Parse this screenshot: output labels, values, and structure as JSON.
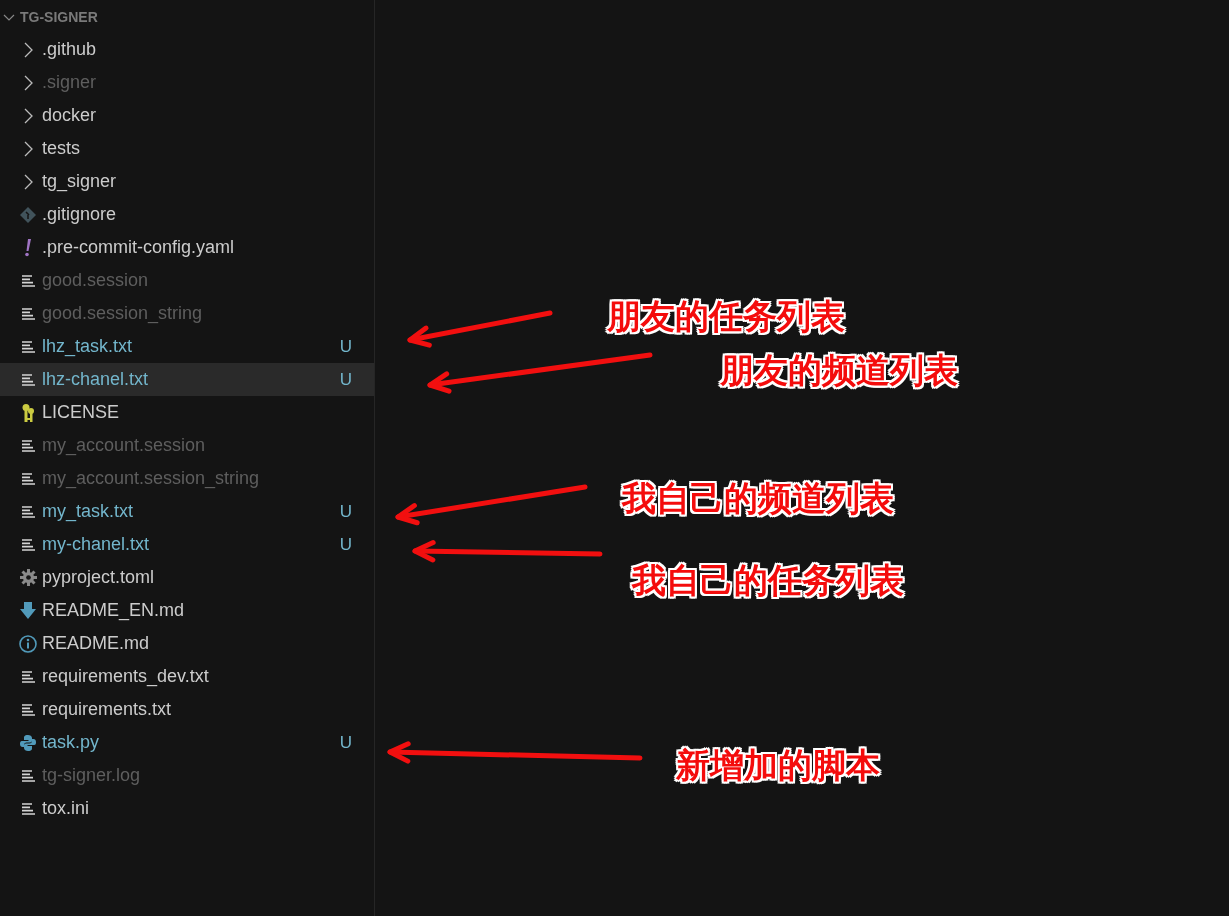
{
  "explorer": {
    "title": "TG-SIGNER",
    "expanded": true,
    "items": [
      {
        "name": ".github",
        "kind": "folder",
        "muted": false,
        "selected": false
      },
      {
        "name": ".signer",
        "kind": "folder",
        "muted": true,
        "selected": false
      },
      {
        "name": "docker",
        "kind": "folder",
        "muted": false,
        "selected": false
      },
      {
        "name": "tests",
        "kind": "folder",
        "muted": false,
        "selected": false
      },
      {
        "name": "tg_signer",
        "kind": "folder",
        "muted": false,
        "selected": false
      },
      {
        "name": ".gitignore",
        "kind": "git",
        "muted": false,
        "selected": false
      },
      {
        "name": ".pre-commit-config.yaml",
        "kind": "yaml",
        "muted": false,
        "selected": false
      },
      {
        "name": "good.session",
        "kind": "text",
        "muted": true,
        "selected": false
      },
      {
        "name": "good.session_string",
        "kind": "text",
        "muted": true,
        "selected": false
      },
      {
        "name": "lhz_task.txt",
        "kind": "text",
        "muted": false,
        "status": "U",
        "selected": false
      },
      {
        "name": "lhz-chanel.txt",
        "kind": "text",
        "muted": false,
        "status": "U",
        "selected": true
      },
      {
        "name": "LICENSE",
        "kind": "license",
        "muted": false,
        "selected": false
      },
      {
        "name": "my_account.session",
        "kind": "text",
        "muted": true,
        "selected": false
      },
      {
        "name": "my_account.session_string",
        "kind": "text",
        "muted": true,
        "selected": false
      },
      {
        "name": "my_task.txt",
        "kind": "text",
        "muted": false,
        "status": "U",
        "selected": false
      },
      {
        "name": "my-chanel.txt",
        "kind": "text",
        "muted": false,
        "status": "U",
        "selected": false
      },
      {
        "name": "pyproject.toml",
        "kind": "config",
        "muted": false,
        "selected": false
      },
      {
        "name": "README_EN.md",
        "kind": "download",
        "muted": false,
        "selected": false
      },
      {
        "name": "README.md",
        "kind": "readme",
        "muted": false,
        "selected": false
      },
      {
        "name": "requirements_dev.txt",
        "kind": "text",
        "muted": false,
        "selected": false
      },
      {
        "name": "requirements.txt",
        "kind": "text",
        "muted": false,
        "selected": false
      },
      {
        "name": "task.py",
        "kind": "python",
        "muted": false,
        "status": "U",
        "selected": false
      },
      {
        "name": "tg-signer.log",
        "kind": "text",
        "muted": true,
        "selected": false
      },
      {
        "name": "tox.ini",
        "kind": "text",
        "muted": false,
        "selected": false
      }
    ]
  },
  "annotations": [
    {
      "text": "朋友的任务列表"
    },
    {
      "text": "朋友的频道列表"
    },
    {
      "text": "我自己的频道列表"
    },
    {
      "text": "我自己的任务列表"
    },
    {
      "text": "新增加的脚本"
    }
  ]
}
